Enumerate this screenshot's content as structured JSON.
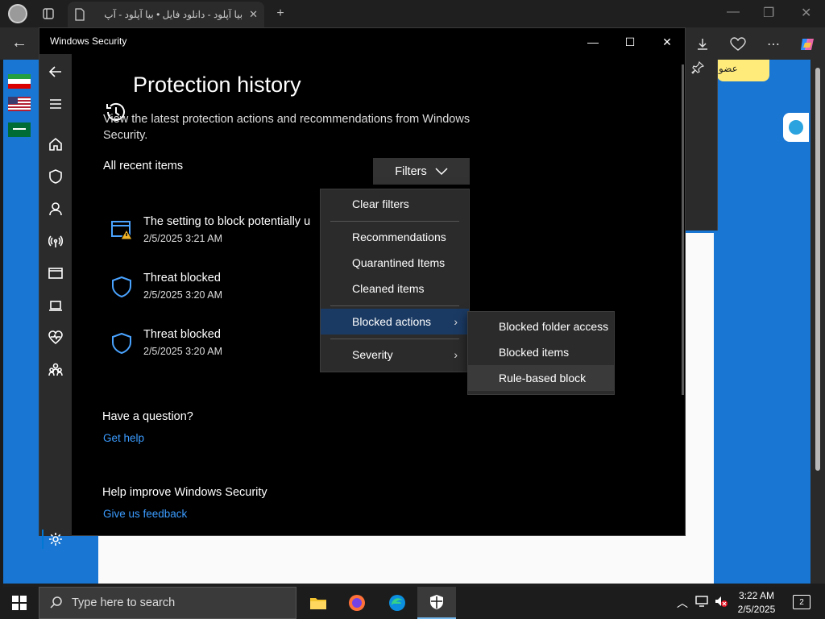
{
  "browser": {
    "tab_title": "بیا آپلود - دانلود فایل • بیا آپلود - آپ",
    "yellow_text": "عضو"
  },
  "security": {
    "window_title": "Windows Security",
    "page_title": "Protection history",
    "description": "View the latest protection actions and recommendations from Windows Security.",
    "all_items_label": "All recent items",
    "filters_label": "Filters",
    "items": [
      {
        "title": "The setting to block potentially u",
        "time": "2/5/2025 3:21 AM",
        "icon": "app-browser-warning-icon"
      },
      {
        "title": "Threat blocked",
        "time": "2/5/2025 3:20 AM",
        "icon": "shield-icon"
      },
      {
        "title": "Threat blocked",
        "time": "2/5/2025 3:20 AM",
        "icon": "shield-icon"
      }
    ],
    "question_heading": "Have a question?",
    "get_help": "Get help",
    "improve_heading": "Help improve Windows Security",
    "feedback": "Give us feedback"
  },
  "filter_menu": {
    "clear": "Clear filters",
    "recommendations": "Recommendations",
    "quarantined": "Quarantined Items",
    "cleaned": "Cleaned items",
    "blocked_actions": "Blocked actions",
    "severity": "Severity"
  },
  "submenu": {
    "folder_access": "Blocked folder access",
    "blocked_items": "Blocked items",
    "rule_based": "Rule-based block"
  },
  "taskbar": {
    "search_placeholder": "Type here to search",
    "time": "3:22 AM",
    "date": "2/5/2025",
    "notification_count": "2"
  },
  "colors": {
    "accent": "#0078d4",
    "link": "#3b9cff",
    "page_blue": "#1976d2"
  }
}
